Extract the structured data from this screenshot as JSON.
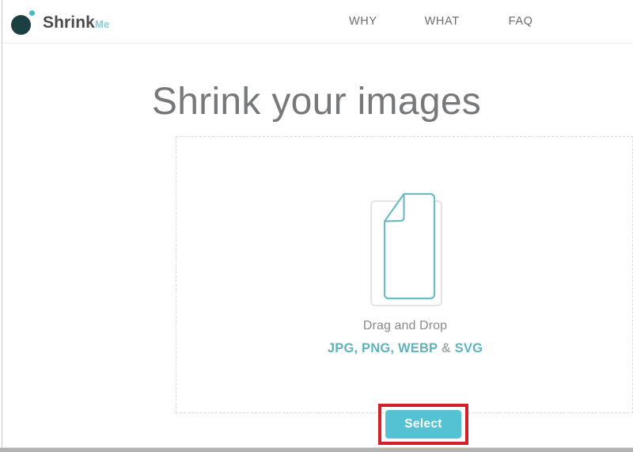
{
  "brand": {
    "primary": "Shrink",
    "secondary": "Me",
    "mark_color": "#1c3f42",
    "accent_dot_color": "#45b9c9"
  },
  "nav": {
    "items": [
      {
        "label": "WHY"
      },
      {
        "label": "WHAT"
      },
      {
        "label": "FAQ"
      }
    ]
  },
  "hero": {
    "title": "Shrink your images"
  },
  "dropzone": {
    "caption": "Drag and Drop",
    "formats_prefix": "JPG, PNG, WEBP",
    "formats_amp": " & ",
    "formats_suffix": "SVG",
    "icon": "document-stack-icon",
    "border_color": "#dcdcdc",
    "icon_color": "#6cbcc4",
    "formats_color": "#5fb3bd"
  },
  "select": {
    "label": "Select",
    "button_color": "#55c2d4",
    "highlight_color": "#d32028"
  }
}
